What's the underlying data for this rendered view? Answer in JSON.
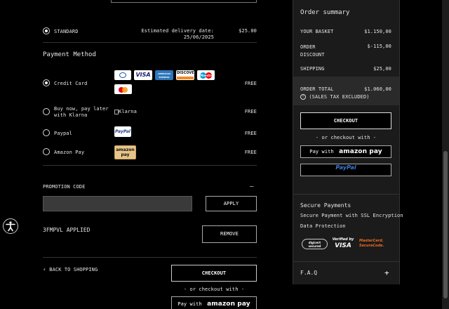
{
  "shipping": {
    "option_label": "STANDARD",
    "delivery_text_1": "Estimated delivery date:",
    "delivery_text_2": "25/06/2025",
    "price": "$25.00"
  },
  "payment": {
    "title": "Payment Method",
    "methods": [
      {
        "label": "Credit Card",
        "price": "FREE"
      },
      {
        "label_1": "Buy now, pay later",
        "label_2": "with Klarna",
        "logo_alt": "Klarna",
        "price": "FREE"
      },
      {
        "label": "Paypal",
        "price": "FREE"
      },
      {
        "label": "Amazon Pay",
        "price": "FREE"
      }
    ],
    "card_logos": [
      "DINERS",
      "VISA",
      "AMERICAN EXPRESS",
      "DISCOVER",
      "Maestro",
      "MC"
    ]
  },
  "promo": {
    "label": "PROMOTION CODE",
    "toggle": "—",
    "apply": "APPLY",
    "applied_code": "3FMPVL APPLIED",
    "remove": "REMOVE"
  },
  "footer": {
    "back": "BACK TO SHOPPING",
    "checkout": "CHECKOUT",
    "or_checkout": "- or checkout with -",
    "pay_with": "Pay with",
    "amazon_pay": "amazon pay"
  },
  "summary": {
    "title": "Order summary",
    "basket_label": "YOUR BASKET",
    "basket_value": "$1.150,00",
    "discount_label_1": "ORDER",
    "discount_label_2": "DISCOUNT",
    "discount_value": "$-115,00",
    "shipping_label": "SHIPPING",
    "shipping_value": "$25,00",
    "total_label": "ORDER TOTAL",
    "total_value": "$1.060,00",
    "tax_note": "(SALES TAX EXCLUDED)",
    "checkout": "CHECKOUT",
    "or_checkout": "- or checkout with -",
    "pay_with": "Pay with",
    "amazon_pay": "amazon pay",
    "paypal": "PayPal",
    "secure_title": "Secure Payments",
    "secure_line_1": "Secure Payment with SSL Encryption",
    "secure_line_2": "Data Protection",
    "badge_digicert": "digicert secured",
    "badge_visa_1": "Verified by",
    "badge_visa_2": "VISA",
    "badge_mc_1": "MasterCard.",
    "badge_mc_2": "SecureCode.",
    "faq": "F.A.Q",
    "faq_toggle": "+"
  }
}
